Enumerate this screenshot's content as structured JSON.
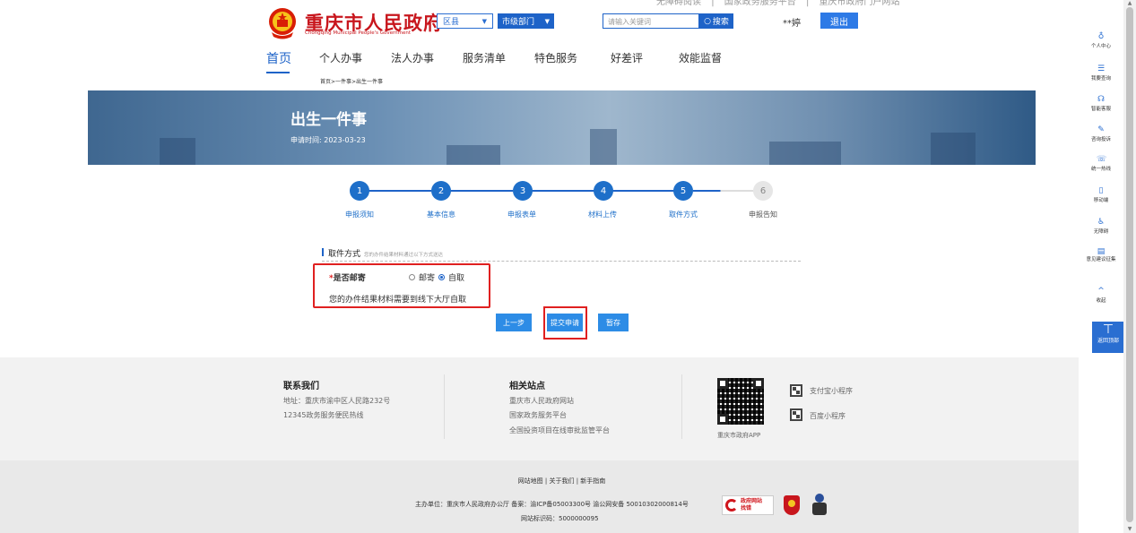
{
  "top_links": {
    "accessibility": "无障碍阅读",
    "national_platform": "国家政务服务平台",
    "city_portal": "重庆市政府门户网站",
    "separator": "|"
  },
  "header": {
    "title": "重庆市人民政府",
    "subtitle": "Chongqing Municipal People's Government",
    "district_select": "区县",
    "dept_select": "市级部门",
    "search_placeholder": "请输入关键词",
    "search_button": "搜索",
    "username": "**婷",
    "logout": "退出"
  },
  "nav": {
    "items": [
      "首页",
      "个人办事",
      "法人办事",
      "服务清单",
      "特色服务",
      "好差评",
      "效能监督"
    ],
    "active_index": 0
  },
  "breadcrumb": "首页>一件事>出生一件事",
  "banner": {
    "title": "出生一件事",
    "date": "申请时间: 2023-03-23"
  },
  "steps": [
    {
      "num": "1",
      "label": "申报须知",
      "done": true
    },
    {
      "num": "2",
      "label": "基本信息",
      "done": true
    },
    {
      "num": "3",
      "label": "申报表单",
      "done": true
    },
    {
      "num": "4",
      "label": "材料上传",
      "done": true
    },
    {
      "num": "5",
      "label": "取件方式",
      "done": true
    },
    {
      "num": "6",
      "label": "申报告知",
      "done": false
    }
  ],
  "form": {
    "section_title": "取件方式",
    "section_note": "您的办件结果材料通过以下方式送达",
    "required_mark": "*",
    "field_label": "是否邮寄",
    "option_mail": "邮寄",
    "option_pickup": "自取",
    "selected": "自取",
    "pickup_message": "您的办件结果材料需要到线下大厅自取",
    "btn_prev": "上一步",
    "btn_submit": "提交申请",
    "btn_save": "暂存"
  },
  "footer": {
    "contact_title": "联系我们",
    "address": "地址：重庆市渝中区人民路232号",
    "hotline": "12345政务服务便民热线",
    "sites_title": "相关站点",
    "sites": [
      "重庆市人民政府网站",
      "国家政务服务平台",
      "全国投资项目在线审批监管平台"
    ],
    "app_label": "重庆市政府APP",
    "alipay": "支付宝小程序",
    "baidu": "百度小程序",
    "links": "网站地图 | 关于我们 | 新手指南",
    "sponsor": "主办单位：重庆市人民政府办公厅 备案：渝ICP备05003300号 渝公网安备 50010302000814号",
    "site_id": "网站标识码：5000000095",
    "gov_badge_line1": "政府网站",
    "gov_badge_line2": "找错"
  },
  "right_panel": {
    "items": [
      "个人中心",
      "我要查询",
      "智能客服",
      "咨询投诉",
      "统一热线",
      "移动端",
      "无障碍",
      "意见建议征集",
      "收起"
    ],
    "back_top": "返回顶部"
  }
}
